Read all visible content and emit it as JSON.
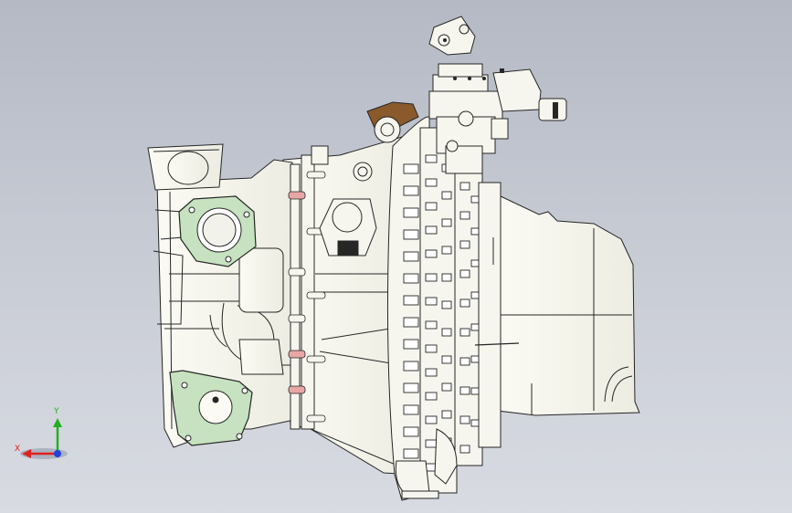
{
  "viewport": {
    "background_top": "#b4b9c4",
    "background_bottom": "#d8dbe2",
    "model_fill": "#f6f6ee",
    "model_stroke": "#262626",
    "flange_fill": "#c6e2c0",
    "accent_brown": "#8a5a2c",
    "accent_pink": "#e8a6a6"
  },
  "triad": {
    "x_label": "X",
    "y_label": "Y",
    "x_color": "#e02020",
    "y_color": "#20b020",
    "z_color": "#2040e0"
  }
}
